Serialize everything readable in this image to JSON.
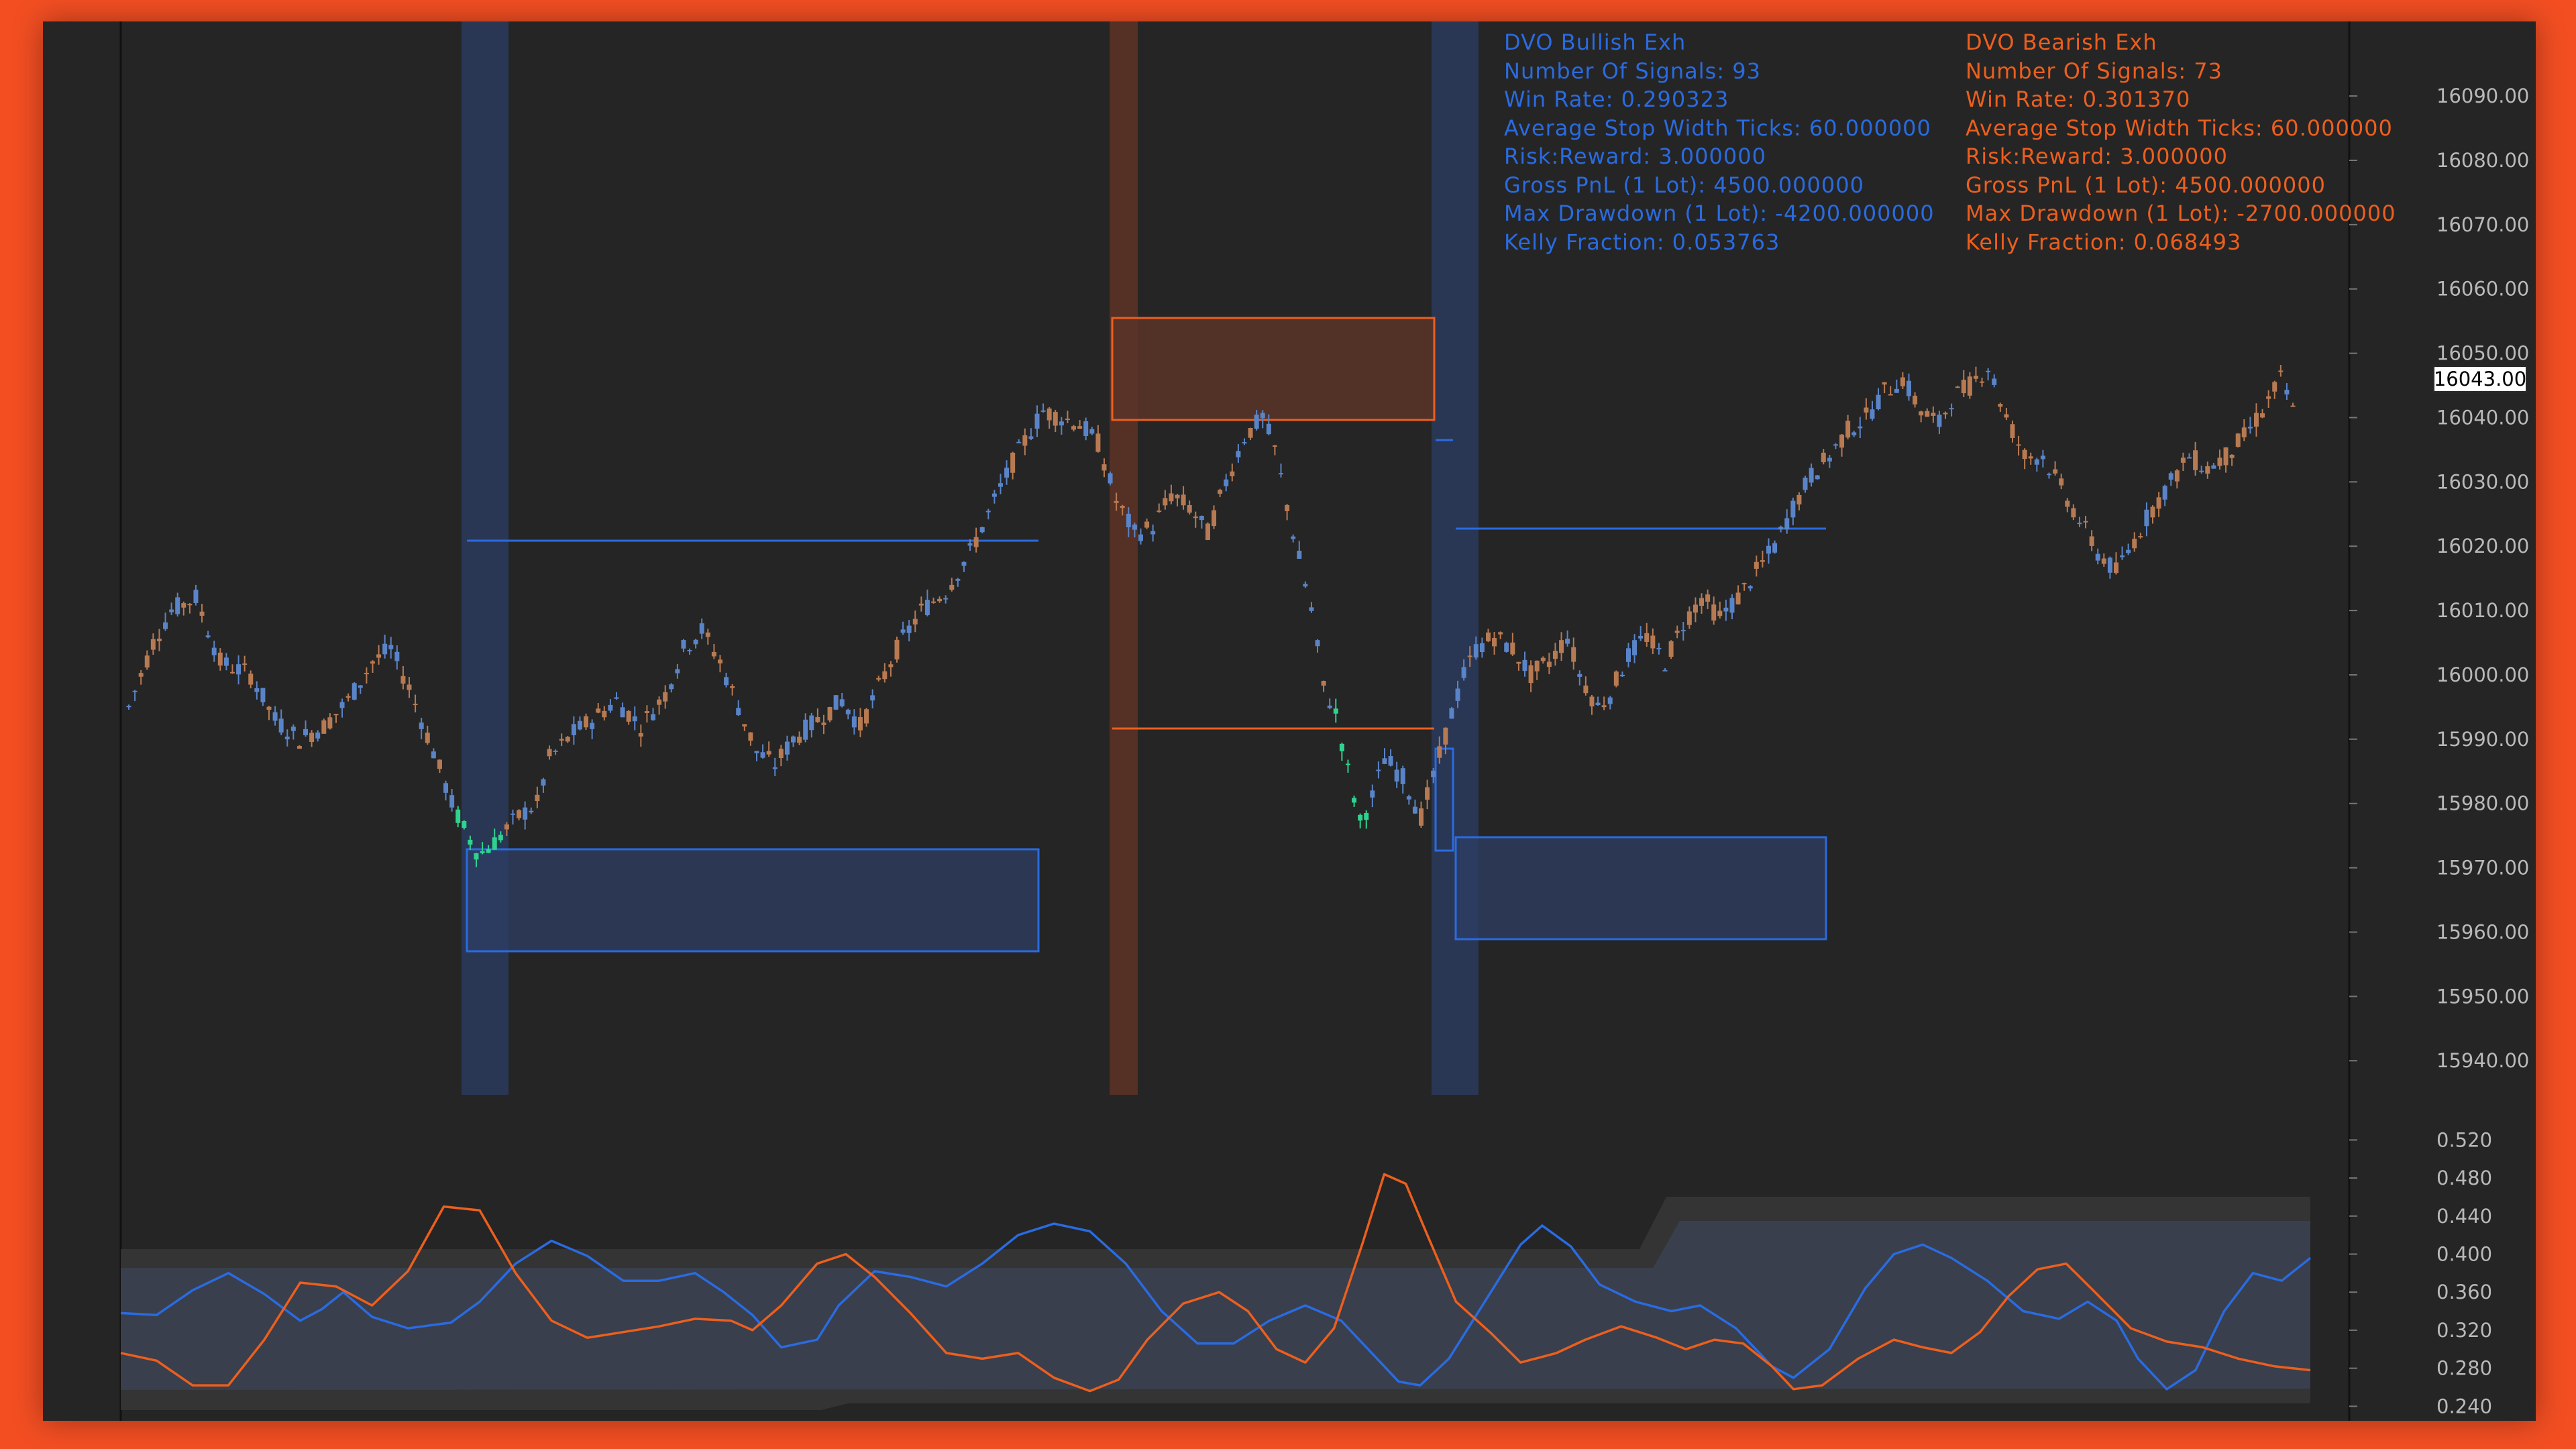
{
  "colors": {
    "frame": "#f24e22",
    "panel": "#252525",
    "bullish": "#2a6be0",
    "bearish": "#ec5f1e",
    "candle_up": "#5a84c8",
    "candle_down": "#b87a52",
    "signal_up": "#2fd38f",
    "axis_text": "#b9b9b9"
  },
  "stats": {
    "bullish": {
      "title": "DVO Bullish Exh",
      "lines": [
        "Number Of Signals: 93",
        "Win Rate: 0.290323",
        "Average Stop Width Ticks: 60.000000",
        "Risk:Reward: 3.000000",
        "Gross PnL (1 Lot): 4500.000000",
        "Max Drawdown (1 Lot): -4200.000000",
        "Kelly Fraction: 0.053763"
      ]
    },
    "bearish": {
      "title": "DVO Bearish Exh",
      "lines": [
        "Number Of Signals: 73",
        "Win Rate: 0.301370",
        "Average Stop Width Ticks: 60.000000",
        "Risk:Reward: 3.000000",
        "Gross PnL (1 Lot): 4500.000000",
        "Max Drawdown (1 Lot): -2700.000000",
        "Kelly Fraction: 0.068493"
      ]
    }
  },
  "chart_data": [
    {
      "type": "candlestick",
      "y_ticks": [
        "16090.00",
        "16080.00",
        "16070.00",
        "16060.00",
        "16050.00",
        "16040.00",
        "16030.00",
        "16020.00",
        "16010.00",
        "16000.00",
        "15990.00",
        "15980.00",
        "15970.00",
        "15960.00",
        "15950.00",
        "15940.00"
      ],
      "ylim": [
        15937,
        16097
      ],
      "last_price": "16043.00",
      "x_range": [
        0,
        332
      ],
      "close_path": [
        [
          0,
          15995
        ],
        [
          8,
          16005
        ],
        [
          14,
          16010
        ],
        [
          22,
          16012
        ],
        [
          30,
          16002
        ],
        [
          40,
          16000
        ],
        [
          48,
          15993
        ],
        [
          56,
          15990
        ],
        [
          64,
          15992
        ],
        [
          72,
          15996
        ],
        [
          80,
          16002
        ],
        [
          86,
          16004
        ],
        [
          92,
          15998
        ],
        [
          100,
          15988
        ],
        [
          106,
          15980
        ],
        [
          110,
          15976
        ],
        [
          115,
          15972
        ],
        [
          120,
          15974
        ],
        [
          124,
          15976
        ],
        [
          128,
          15978
        ],
        [
          134,
          15980
        ],
        [
          138,
          15987
        ],
        [
          146,
          15991
        ],
        [
          152,
          15993
        ],
        [
          160,
          15996
        ],
        [
          168,
          15992
        ],
        [
          176,
          15997
        ],
        [
          182,
          16004
        ],
        [
          188,
          16007
        ],
        [
          194,
          16002
        ],
        [
          200,
          15995
        ],
        [
          206,
          15988
        ],
        [
          212,
          15986
        ],
        [
          218,
          15990
        ],
        [
          226,
          15993
        ],
        [
          234,
          15996
        ],
        [
          240,
          15992
        ],
        [
          246,
          15998
        ],
        [
          252,
          16004
        ],
        [
          260,
          16010
        ],
        [
          268,
          16013
        ],
        [
          276,
          16019
        ],
        [
          284,
          16027
        ],
        [
          290,
          16033
        ],
        [
          296,
          16038
        ],
        [
          300,
          16041
        ],
        [
          306,
          16040
        ],
        [
          312,
          16039
        ],
        [
          318,
          16036
        ],
        [
          324,
          16027
        ],
        [
          330,
          16022
        ],
        [
          336,
          16023
        ],
        [
          342,
          16028
        ],
        [
          348,
          16026
        ],
        [
          354,
          16022
        ],
        [
          360,
          16030
        ],
        [
          366,
          16037
        ],
        [
          372,
          16040
        ],
        [
          376,
          16035
        ],
        [
          382,
          16022
        ],
        [
          388,
          16010
        ],
        [
          392,
          15998
        ],
        [
          396,
          15994
        ],
        [
          400,
          15985
        ],
        [
          404,
          15977
        ],
        [
          408,
          15981
        ],
        [
          412,
          15987
        ],
        [
          418,
          15984
        ],
        [
          424,
          15978
        ],
        [
          428,
          15984
        ],
        [
          434,
          15994
        ],
        [
          438,
          16000
        ],
        [
          442,
          16004
        ],
        [
          448,
          16006
        ],
        [
          454,
          16004
        ],
        [
          460,
          16000
        ],
        [
          466,
          16002
        ],
        [
          472,
          16006
        ],
        [
          476,
          16000
        ],
        [
          482,
          15995
        ],
        [
          486,
          15997
        ],
        [
          492,
          16003
        ],
        [
          498,
          16006
        ],
        [
          504,
          16002
        ],
        [
          510,
          16008
        ],
        [
          516,
          16012
        ],
        [
          522,
          16009
        ],
        [
          528,
          16012
        ],
        [
          534,
          16016
        ],
        [
          540,
          16020
        ],
        [
          546,
          16026
        ],
        [
          552,
          16031
        ],
        [
          558,
          16034
        ],
        [
          564,
          16038
        ],
        [
          570,
          16040
        ],
        [
          576,
          16044
        ],
        [
          582,
          16046
        ],
        [
          588,
          16041
        ],
        [
          594,
          16039
        ],
        [
          598,
          16043
        ],
        [
          604,
          16045
        ],
        [
          610,
          16048
        ],
        [
          616,
          16040
        ],
        [
          622,
          16034
        ],
        [
          628,
          16034
        ],
        [
          634,
          16029
        ],
        [
          640,
          16024
        ],
        [
          646,
          16019
        ],
        [
          652,
          16016
        ],
        [
          658,
          16021
        ],
        [
          664,
          16026
        ],
        [
          670,
          16030
        ],
        [
          676,
          16034
        ],
        [
          682,
          16032
        ],
        [
          688,
          16034
        ],
        [
          694,
          16037
        ],
        [
          700,
          16041
        ],
        [
          706,
          16046
        ],
        [
          710,
          16041
        ]
      ],
      "x_scale_note": ""
    },
    {
      "type": "line",
      "y_ticks": [
        "0.520",
        "0.480",
        "0.440",
        "0.400",
        "0.360",
        "0.320",
        "0.280",
        "0.240"
      ],
      "ylim": [
        0.236,
        0.528
      ],
      "series": [
        {
          "points": [
            [
              0,
              0.338
            ],
            [
              10,
              0.336
            ],
            [
              20,
              0.362
            ],
            [
              30,
              0.38
            ],
            [
              40,
              0.358
            ],
            [
              50,
              0.33
            ],
            [
              56,
              0.342
            ],
            [
              62,
              0.36
            ],
            [
              70,
              0.334
            ],
            [
              80,
              0.322
            ],
            [
              92,
              0.328
            ],
            [
              100,
              0.35
            ],
            [
              110,
              0.39
            ],
            [
              120,
              0.414
            ],
            [
              130,
              0.398
            ],
            [
              140,
              0.372
            ],
            [
              150,
              0.372
            ],
            [
              160,
              0.38
            ],
            [
              168,
              0.36
            ],
            [
              176,
              0.336
            ],
            [
              184,
              0.302
            ],
            [
              194,
              0.31
            ],
            [
              200,
              0.346
            ],
            [
              210,
              0.382
            ],
            [
              220,
              0.376
            ],
            [
              230,
              0.366
            ],
            [
              240,
              0.39
            ],
            [
              250,
              0.42
            ],
            [
              260,
              0.432
            ],
            [
              270,
              0.424
            ],
            [
              280,
              0.39
            ],
            [
              290,
              0.34
            ],
            [
              300,
              0.306
            ],
            [
              310,
              0.306
            ],
            [
              320,
              0.33
            ],
            [
              330,
              0.346
            ],
            [
              340,
              0.33
            ],
            [
              350,
              0.29
            ],
            [
              356,
              0.266
            ],
            [
              362,
              0.262
            ],
            [
              370,
              0.29
            ],
            [
              380,
              0.35
            ],
            [
              390,
              0.41
            ],
            [
              396,
              0.43
            ],
            [
              404,
              0.408
            ],
            [
              412,
              0.368
            ],
            [
              422,
              0.35
            ],
            [
              432,
              0.34
            ],
            [
              440,
              0.346
            ],
            [
              450,
              0.322
            ],
            [
              460,
              0.282
            ],
            [
              466,
              0.27
            ],
            [
              476,
              0.3
            ],
            [
              486,
              0.364
            ],
            [
              494,
              0.4
            ],
            [
              502,
              0.41
            ],
            [
              510,
              0.396
            ],
            [
              520,
              0.372
            ],
            [
              530,
              0.34
            ],
            [
              540,
              0.332
            ],
            [
              548,
              0.35
            ],
            [
              556,
              0.33
            ],
            [
              562,
              0.29
            ],
            [
              570,
              0.258
            ],
            [
              578,
              0.278
            ],
            [
              586,
              0.34
            ],
            [
              594,
              0.38
            ],
            [
              602,
              0.372
            ],
            [
              610,
              0.396
            ]
          ]
        },
        {
          "points": [
            [
              0,
              0.296
            ],
            [
              10,
              0.288
            ],
            [
              20,
              0.262
            ],
            [
              30,
              0.262
            ],
            [
              40,
              0.31
            ],
            [
              50,
              0.37
            ],
            [
              60,
              0.366
            ],
            [
              70,
              0.346
            ],
            [
              80,
              0.382
            ],
            [
              90,
              0.45
            ],
            [
              100,
              0.446
            ],
            [
              110,
              0.38
            ],
            [
              120,
              0.33
            ],
            [
              130,
              0.312
            ],
            [
              140,
              0.318
            ],
            [
              150,
              0.324
            ],
            [
              160,
              0.332
            ],
            [
              170,
              0.33
            ],
            [
              176,
              0.32
            ],
            [
              184,
              0.346
            ],
            [
              194,
              0.39
            ],
            [
              202,
              0.4
            ],
            [
              210,
              0.376
            ],
            [
              220,
              0.338
            ],
            [
              230,
              0.296
            ],
            [
              240,
              0.29
            ],
            [
              250,
              0.296
            ],
            [
              260,
              0.27
            ],
            [
              270,
              0.256
            ],
            [
              278,
              0.268
            ],
            [
              286,
              0.31
            ],
            [
              296,
              0.348
            ],
            [
              306,
              0.36
            ],
            [
              314,
              0.34
            ],
            [
              322,
              0.3
            ],
            [
              330,
              0.286
            ],
            [
              338,
              0.322
            ],
            [
              346,
              0.412
            ],
            [
              352,
              0.484
            ],
            [
              358,
              0.474
            ],
            [
              364,
              0.42
            ],
            [
              372,
              0.35
            ],
            [
              382,
              0.316
            ],
            [
              390,
              0.286
            ],
            [
              400,
              0.296
            ],
            [
              408,
              0.31
            ],
            [
              418,
              0.324
            ],
            [
              428,
              0.312
            ],
            [
              436,
              0.3
            ],
            [
              444,
              0.31
            ],
            [
              452,
              0.306
            ],
            [
              460,
              0.282
            ],
            [
              466,
              0.258
            ],
            [
              474,
              0.262
            ],
            [
              484,
              0.29
            ],
            [
              494,
              0.31
            ],
            [
              502,
              0.302
            ],
            [
              510,
              0.296
            ],
            [
              518,
              0.318
            ],
            [
              526,
              0.356
            ],
            [
              534,
              0.384
            ],
            [
              542,
              0.39
            ],
            [
              550,
              0.36
            ],
            [
              560,
              0.322
            ],
            [
              570,
              0.308
            ],
            [
              580,
              0.302
            ],
            [
              590,
              0.29
            ],
            [
              600,
              0.282
            ],
            [
              610,
              0.278
            ]
          ]
        }
      ]
    }
  ]
}
